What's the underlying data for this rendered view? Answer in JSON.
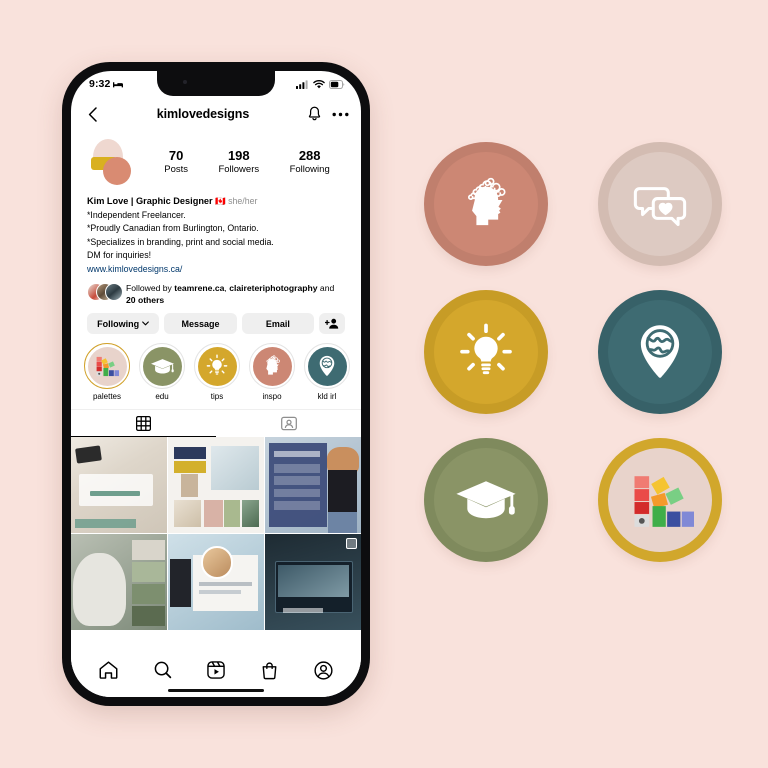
{
  "page": {
    "background_color": "#f9e2dc"
  },
  "phone": {
    "status_bar": {
      "time": "9:32",
      "sleep_icon": "bed-icon",
      "signal_icon": "cellular-signal-icon",
      "wifi_icon": "wifi-icon",
      "battery_icon": "battery-icon"
    },
    "header": {
      "back_icon": "back-chevron-icon",
      "username": "kimlovedesigns",
      "notify_icon": "bell-icon",
      "more_icon": "more-options-icon"
    },
    "profile": {
      "avatar_name": "profile-avatar",
      "stats": [
        {
          "number": "70",
          "label": "Posts"
        },
        {
          "number": "198",
          "label": "Followers"
        },
        {
          "number": "288",
          "label": "Following"
        }
      ],
      "bio": {
        "name": "Kim Love | Graphic Designer",
        "flag": "🇨🇦",
        "pronouns": "she/her",
        "line1": "*Independent Freelancer.",
        "line2": "*Proudly Canadian from Burlington, Ontario.",
        "line3": "*Specializes in branding, print and social media.",
        "line4": "DM for inquiries!",
        "link": "www.kimlovedesigns.ca/"
      },
      "followed_by": {
        "prefix": "Followed by ",
        "user1": "teamrene.ca",
        "separator": ", ",
        "user2": "claireteriphotography",
        "suffix": " and ",
        "others": "20 others"
      },
      "actions": [
        {
          "label": "Following",
          "icon": "chevron-down-icon",
          "name": "following-button"
        },
        {
          "label": "Message",
          "icon": "",
          "name": "message-button"
        },
        {
          "label": "Email",
          "icon": "",
          "name": "email-button"
        },
        {
          "label": "",
          "icon": "add-person-icon",
          "name": "add-person-button"
        }
      ],
      "highlights": [
        {
          "label": "palettes",
          "icon": "color-palette-icon",
          "color": "#e8d3cb",
          "ring": "#d1a12a"
        },
        {
          "label": "edu",
          "icon": "graduation-cap-icon",
          "color": "#8a9466",
          "ring": "#e4e4e4"
        },
        {
          "label": "tips",
          "icon": "lightbulb-icon",
          "color": "#d4a72c",
          "ring": "#e4e4e4"
        },
        {
          "label": "inspo",
          "icon": "head-ideas-icon",
          "color": "#cc8774",
          "ring": "#e4e4e4"
        },
        {
          "label": "kld irl",
          "icon": "map-pin-globe-icon",
          "color": "#3e6b72",
          "ring": "#e4e4e4"
        }
      ]
    },
    "tabs": [
      {
        "name": "tab-grid",
        "icon": "grid-icon",
        "active": true
      },
      {
        "name": "tab-tagged",
        "icon": "tagged-icon",
        "active": false
      }
    ],
    "bottom_nav": [
      {
        "name": "nav-home",
        "icon": "home-icon"
      },
      {
        "name": "nav-search",
        "icon": "search-icon"
      },
      {
        "name": "nav-reels",
        "icon": "reels-icon"
      },
      {
        "name": "nav-shop",
        "icon": "shop-bag-icon"
      },
      {
        "name": "nav-profile",
        "icon": "profile-circle-icon"
      }
    ]
  },
  "badges": [
    {
      "name": "badge-head-ideas",
      "icon": "head-ideas-icon",
      "fill": "#cc8774",
      "rim": "#c07f6d",
      "glyph": "#ffffff"
    },
    {
      "name": "badge-chat-heart",
      "icon": "chat-heart-icon",
      "fill": "#ddcac2",
      "rim": "#d3bcb2",
      "glyph": "#ffffff"
    },
    {
      "name": "badge-lightbulb",
      "icon": "lightbulb-icon",
      "fill": "#d4a72c",
      "rim": "#c79c26",
      "glyph": "#ffffff"
    },
    {
      "name": "badge-map-pin-globe",
      "icon": "map-pin-globe-icon",
      "fill": "#3e6b72",
      "rim": "#376168",
      "glyph": "#ffffff"
    },
    {
      "name": "badge-graduation",
      "icon": "graduation-cap-icon",
      "fill": "#8a9466",
      "rim": "#7f8a5d",
      "glyph": "#ffffff"
    },
    {
      "name": "badge-color-palette",
      "icon": "color-palette-icon",
      "fill": "#e8d3cb",
      "rim": "#d1a72c",
      "glyph": "#ffffff"
    }
  ]
}
